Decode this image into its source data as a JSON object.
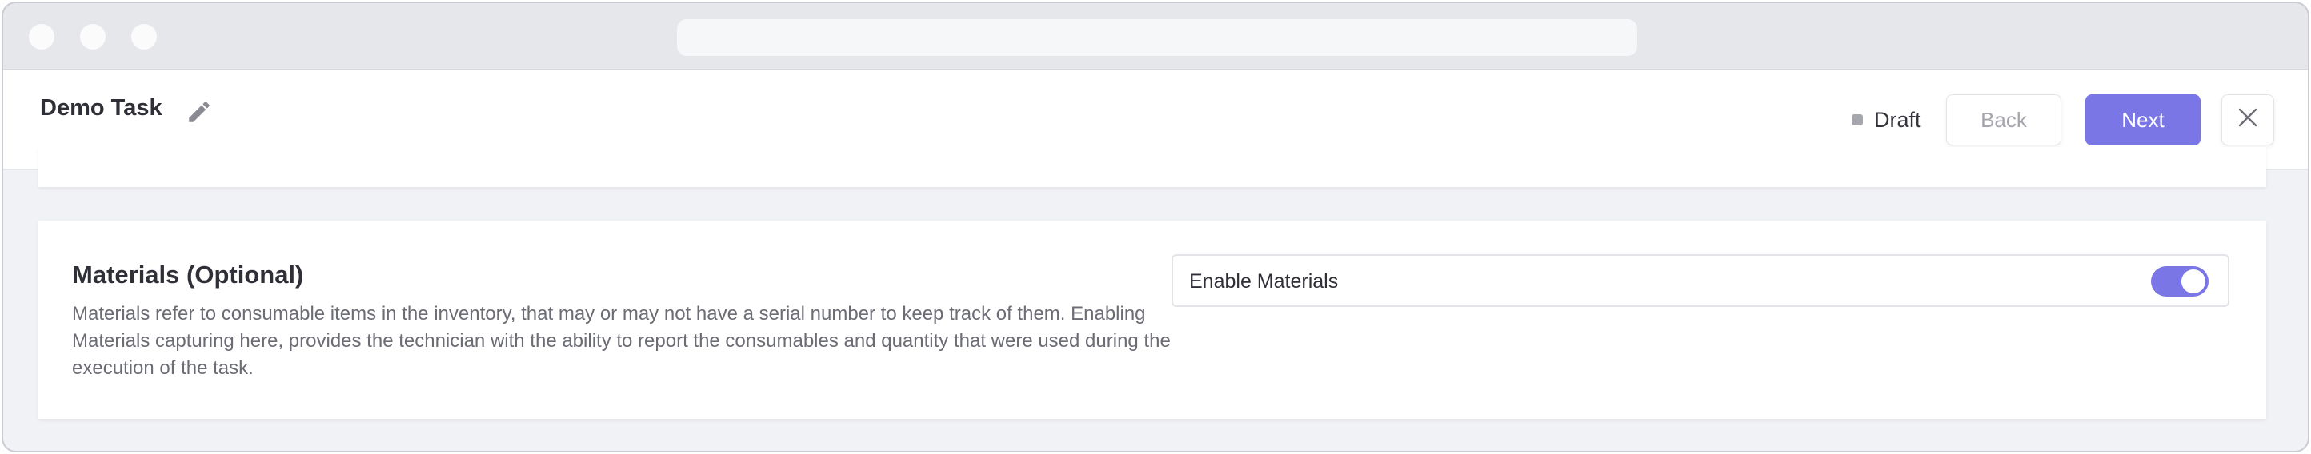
{
  "header": {
    "task_title": "Demo Task",
    "status_label": "Draft",
    "back_label": "Back",
    "next_label": "Next"
  },
  "materials": {
    "title": "Materials (Optional)",
    "description": "Materials refer to consumable items in the inventory, that may or may not have a serial number to keep track of them. Enabling Materials capturing here, provides the technician with the ability to report the consumables and quantity that were used during the execution of the task.",
    "toggle_label": "Enable Materials",
    "toggle_on": true
  },
  "icons": {
    "edit": "pencil-icon",
    "close": "close-icon"
  },
  "colors": {
    "accent": "#7b76e6",
    "draft_indicator": "#a6a7ad"
  }
}
